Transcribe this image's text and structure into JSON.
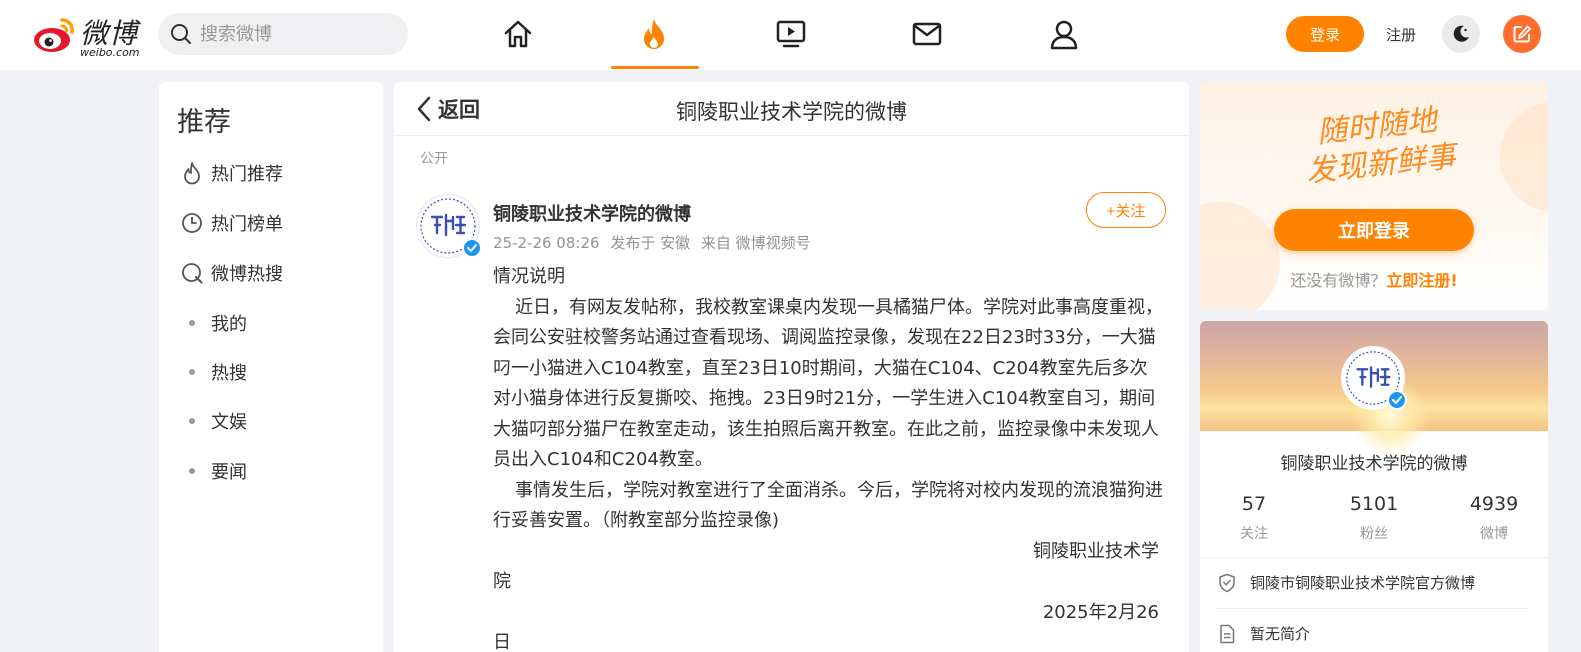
{
  "header": {
    "logo_cn": "微博",
    "logo_en": "weibo.com",
    "search_placeholder": "搜索微博",
    "nav": [
      "home-icon",
      "hot-flame-icon",
      "video-icon",
      "mail-icon",
      "user-icon"
    ],
    "nav_active": "hot-flame-icon",
    "login_label": "登录",
    "register_label": "注册",
    "accent": "#ff8200"
  },
  "sidebar": {
    "title": "推荐",
    "items": [
      {
        "label": "热门推荐",
        "icon": "flame-outline-icon"
      },
      {
        "label": "热门榜单",
        "icon": "clock-icon"
      },
      {
        "label": "微博热搜",
        "icon": "search-circle-icon"
      },
      {
        "label": "我的",
        "icon": "dot"
      },
      {
        "label": "热搜",
        "icon": "dot"
      },
      {
        "label": "文娱",
        "icon": "dot"
      },
      {
        "label": "要闻",
        "icon": "dot"
      }
    ]
  },
  "main": {
    "back_label": "返回",
    "title": "铜陵职业技术学院的微博",
    "visibility": "公开",
    "post": {
      "author": "铜陵职业技术学院的微博",
      "time": "25-2-26 08:26",
      "location": "发布于 安徽",
      "source": "来自 微博视频号",
      "follow_label": "+关注",
      "heading": "情况说明",
      "para1": "近日，有网友发帖称，我校教室课桌内发现一具橘猫尸体。学院对此事高度重视，会同公安驻校警务站通过查看现场、调阅监控录像，发现在22日23时33分，一大猫叼一小猫进入C104教室，直至23日10时期间，大猫在C104、C204教室先后多次对小猫身体进行反复撕咬、拖拽。23日9时21分，一学生进入C104教室自习，期间大猫叼部分猫尸在教室走动，该生拍照后离开教室。在此之前，监控录像中未发现人员出入C104和C204教室。",
      "para2": "事情发生后，学院对教室进行了全面消杀。今后，学院将对校内发现的流浪猫狗进行妥善安置。（附教室部分监控录像)",
      "sign_line1": "铜陵职业技术学",
      "sign_line2": "院",
      "date_line1": "2025年2月26",
      "date_line2": "日"
    }
  },
  "right": {
    "slogan_line1": "随时随地",
    "slogan_line2": "发现新鲜事",
    "login_now": "立即登录",
    "no_account": "还没有微博？",
    "register_now": "立即注册!",
    "profile": {
      "name": "铜陵职业技术学院的微博",
      "stats": [
        {
          "num": "57",
          "label": "关注"
        },
        {
          "num": "5101",
          "label": "粉丝"
        },
        {
          "num": "4939",
          "label": "微博"
        }
      ],
      "verified": "铜陵市铜陵职业技术学院官方微博",
      "intro": "暂无简介"
    }
  }
}
